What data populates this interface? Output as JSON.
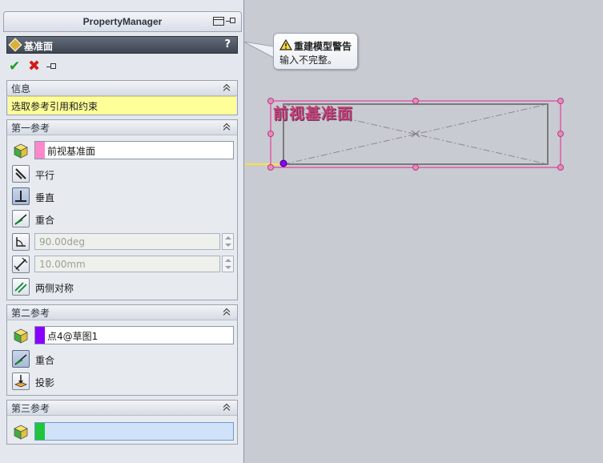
{
  "panel": {
    "title": "PropertyManager",
    "feature_title": "基准面",
    "help": "?"
  },
  "info": {
    "header": "信息",
    "message": "选取参考引用和约束"
  },
  "ref1": {
    "header": "第一参考",
    "selection": "前视基准面",
    "swatch_color": "#ff88cc",
    "options": {
      "parallel": "平行",
      "perpendicular": "垂直",
      "coincident": "重合",
      "flip_symmetric": "两侧对称"
    },
    "angle_value": "90.00deg",
    "distance_value": "10.00mm"
  },
  "ref2": {
    "header": "第二参考",
    "selection": "点4@草图1",
    "swatch_color": "#8a00ff",
    "options": {
      "coincident": "重合",
      "project": "投影"
    }
  },
  "ref3": {
    "header": "第三参考",
    "selection": "",
    "swatch_color": "#1fc53a"
  },
  "tooltip": {
    "title": "重建模型警告",
    "body": "输入不完整。"
  },
  "graphics": {
    "plane_label": "前视基准面",
    "highlight_color": "#e05aa8",
    "sketch_line_color": "#ffe33a"
  }
}
